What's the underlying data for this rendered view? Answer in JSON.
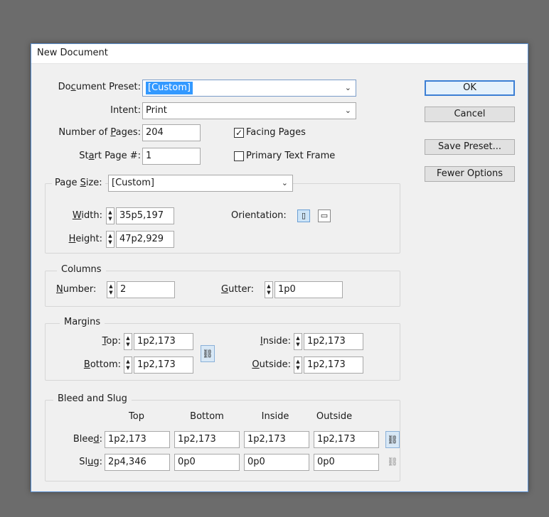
{
  "window": {
    "title": "New Document"
  },
  "preset": {
    "label": "Document Preset:",
    "value": "[Custom]"
  },
  "intent": {
    "label": "Intent:",
    "value": "Print"
  },
  "pages": {
    "label": "Number of Pages:",
    "value": "204"
  },
  "start_page": {
    "label": "Start Page #:",
    "value": "1"
  },
  "facing_pages": {
    "label": "Facing Pages",
    "checked": true,
    "mark": "✓"
  },
  "primary_text_frame": {
    "label": "Primary Text Frame",
    "checked": false
  },
  "page_size": {
    "label": "Page Size:",
    "value": "[Custom]",
    "width_label": "Width:",
    "width_value": "35p5,197",
    "height_label": "Height:",
    "height_value": "47p2,929",
    "orientation_label": "Orientation:"
  },
  "columns": {
    "title": "Columns",
    "number_label": "Number:",
    "number_value": "2",
    "gutter_label": "Gutter:",
    "gutter_value": "1p0"
  },
  "margins": {
    "title": "Margins",
    "top_label": "Top:",
    "top_value": "1p2,173",
    "bottom_label": "Bottom:",
    "bottom_value": "1p2,173",
    "inside_label": "Inside:",
    "inside_value": "1p2,173",
    "outside_label": "Outside:",
    "outside_value": "1p2,173"
  },
  "bleed_slug": {
    "title": "Bleed and Slug",
    "columns": [
      "Top",
      "Bottom",
      "Inside",
      "Outside"
    ],
    "bleed_label": "Bleed:",
    "bleed": [
      "1p2,173",
      "1p2,173",
      "1p2,173",
      "1p2,173"
    ],
    "slug_label": "Slug:",
    "slug": [
      "2p4,346",
      "0p0",
      "0p0",
      "0p0"
    ]
  },
  "buttons": {
    "ok": "OK",
    "cancel": "Cancel",
    "save_preset": "Save Preset...",
    "fewer_options": "Fewer Options"
  },
  "icons": {
    "chevron": "⌄",
    "spin_up": "▲",
    "spin_down": "▼",
    "chain": "⛓",
    "portrait": "▯",
    "landscape": "▭"
  },
  "colors": {
    "accent": "#3399ff",
    "background": "#6c6c6c",
    "dialog": "#f0f0f0"
  }
}
